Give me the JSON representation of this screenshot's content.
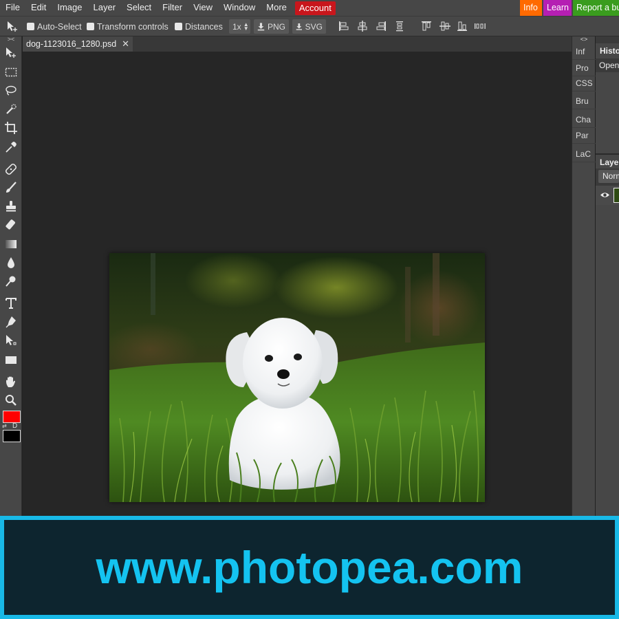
{
  "menubar": {
    "items": [
      "File",
      "Edit",
      "Image",
      "Layer",
      "Select",
      "Filter",
      "View",
      "Window",
      "More"
    ],
    "account": "Account",
    "info": "Info",
    "learn": "Learn",
    "report": "Report a bug",
    "colors": {
      "account": "#c8161c",
      "info": "#ff6a00",
      "learn": "#b51fb3",
      "report": "#3a9c1e"
    }
  },
  "options": {
    "auto_select": "Auto-Select",
    "transform_controls": "Transform controls",
    "distances": "Distances",
    "zoom": "1x",
    "export_png": "PNG",
    "export_svg": "SVG"
  },
  "document": {
    "tab_title": "dog-1123016_1280.psd",
    "close": "✕"
  },
  "panel_strip": {
    "collapse": "<>",
    "items": [
      "Inf",
      "Pro",
      "CSS",
      "Bru",
      "Cha",
      "Par",
      "LaC"
    ]
  },
  "left_collapse": "><",
  "history": {
    "title": "History",
    "rows": [
      "Open"
    ]
  },
  "layers": {
    "title": "Layers",
    "blend_mode": "Normal"
  },
  "colors": {
    "foreground": "#ff0000",
    "background": "#000000",
    "default_label": "D"
  },
  "banner": {
    "text": "www.photopea.com",
    "color": "#14c3f0"
  }
}
